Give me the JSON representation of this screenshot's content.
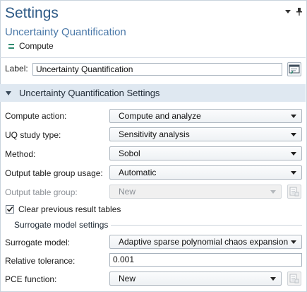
{
  "panel": {
    "title": "Settings",
    "subtitle": "Uncertainty Quantification",
    "node_label": "Compute",
    "colors": {
      "title": "#2f5b87",
      "section_bg": "#dfe8f1",
      "node_icon": "#2f8b70"
    }
  },
  "label_field": {
    "label": "Label:",
    "value": "Uncertainty Quantification",
    "button_icon": "edit-label-icon"
  },
  "section": {
    "title": "Uncertainty Quantification Settings",
    "expanded": true
  },
  "fields": {
    "compute_action": {
      "label": "Compute action:",
      "value": "Compute and analyze"
    },
    "uq_study_type": {
      "label": "UQ study type:",
      "value": "Sensitivity analysis"
    },
    "method": {
      "label": "Method:",
      "value": "Sobol"
    },
    "output_table_group_usage": {
      "label": "Output table group usage:",
      "value": "Automatic"
    },
    "output_table_group": {
      "label": "Output table group:",
      "value": "New",
      "disabled": true
    },
    "clear_previous": {
      "label": "Clear previous result tables",
      "checked": true
    },
    "surrogate_heading": "Surrogate model settings",
    "surrogate_model": {
      "label": "Surrogate model:",
      "value": "Adaptive sparse polynomial chaos expansion"
    },
    "relative_tolerance": {
      "label": "Relative tolerance:",
      "value": "0.001"
    },
    "pce_function": {
      "label": "PCE function:",
      "value": "New"
    }
  }
}
